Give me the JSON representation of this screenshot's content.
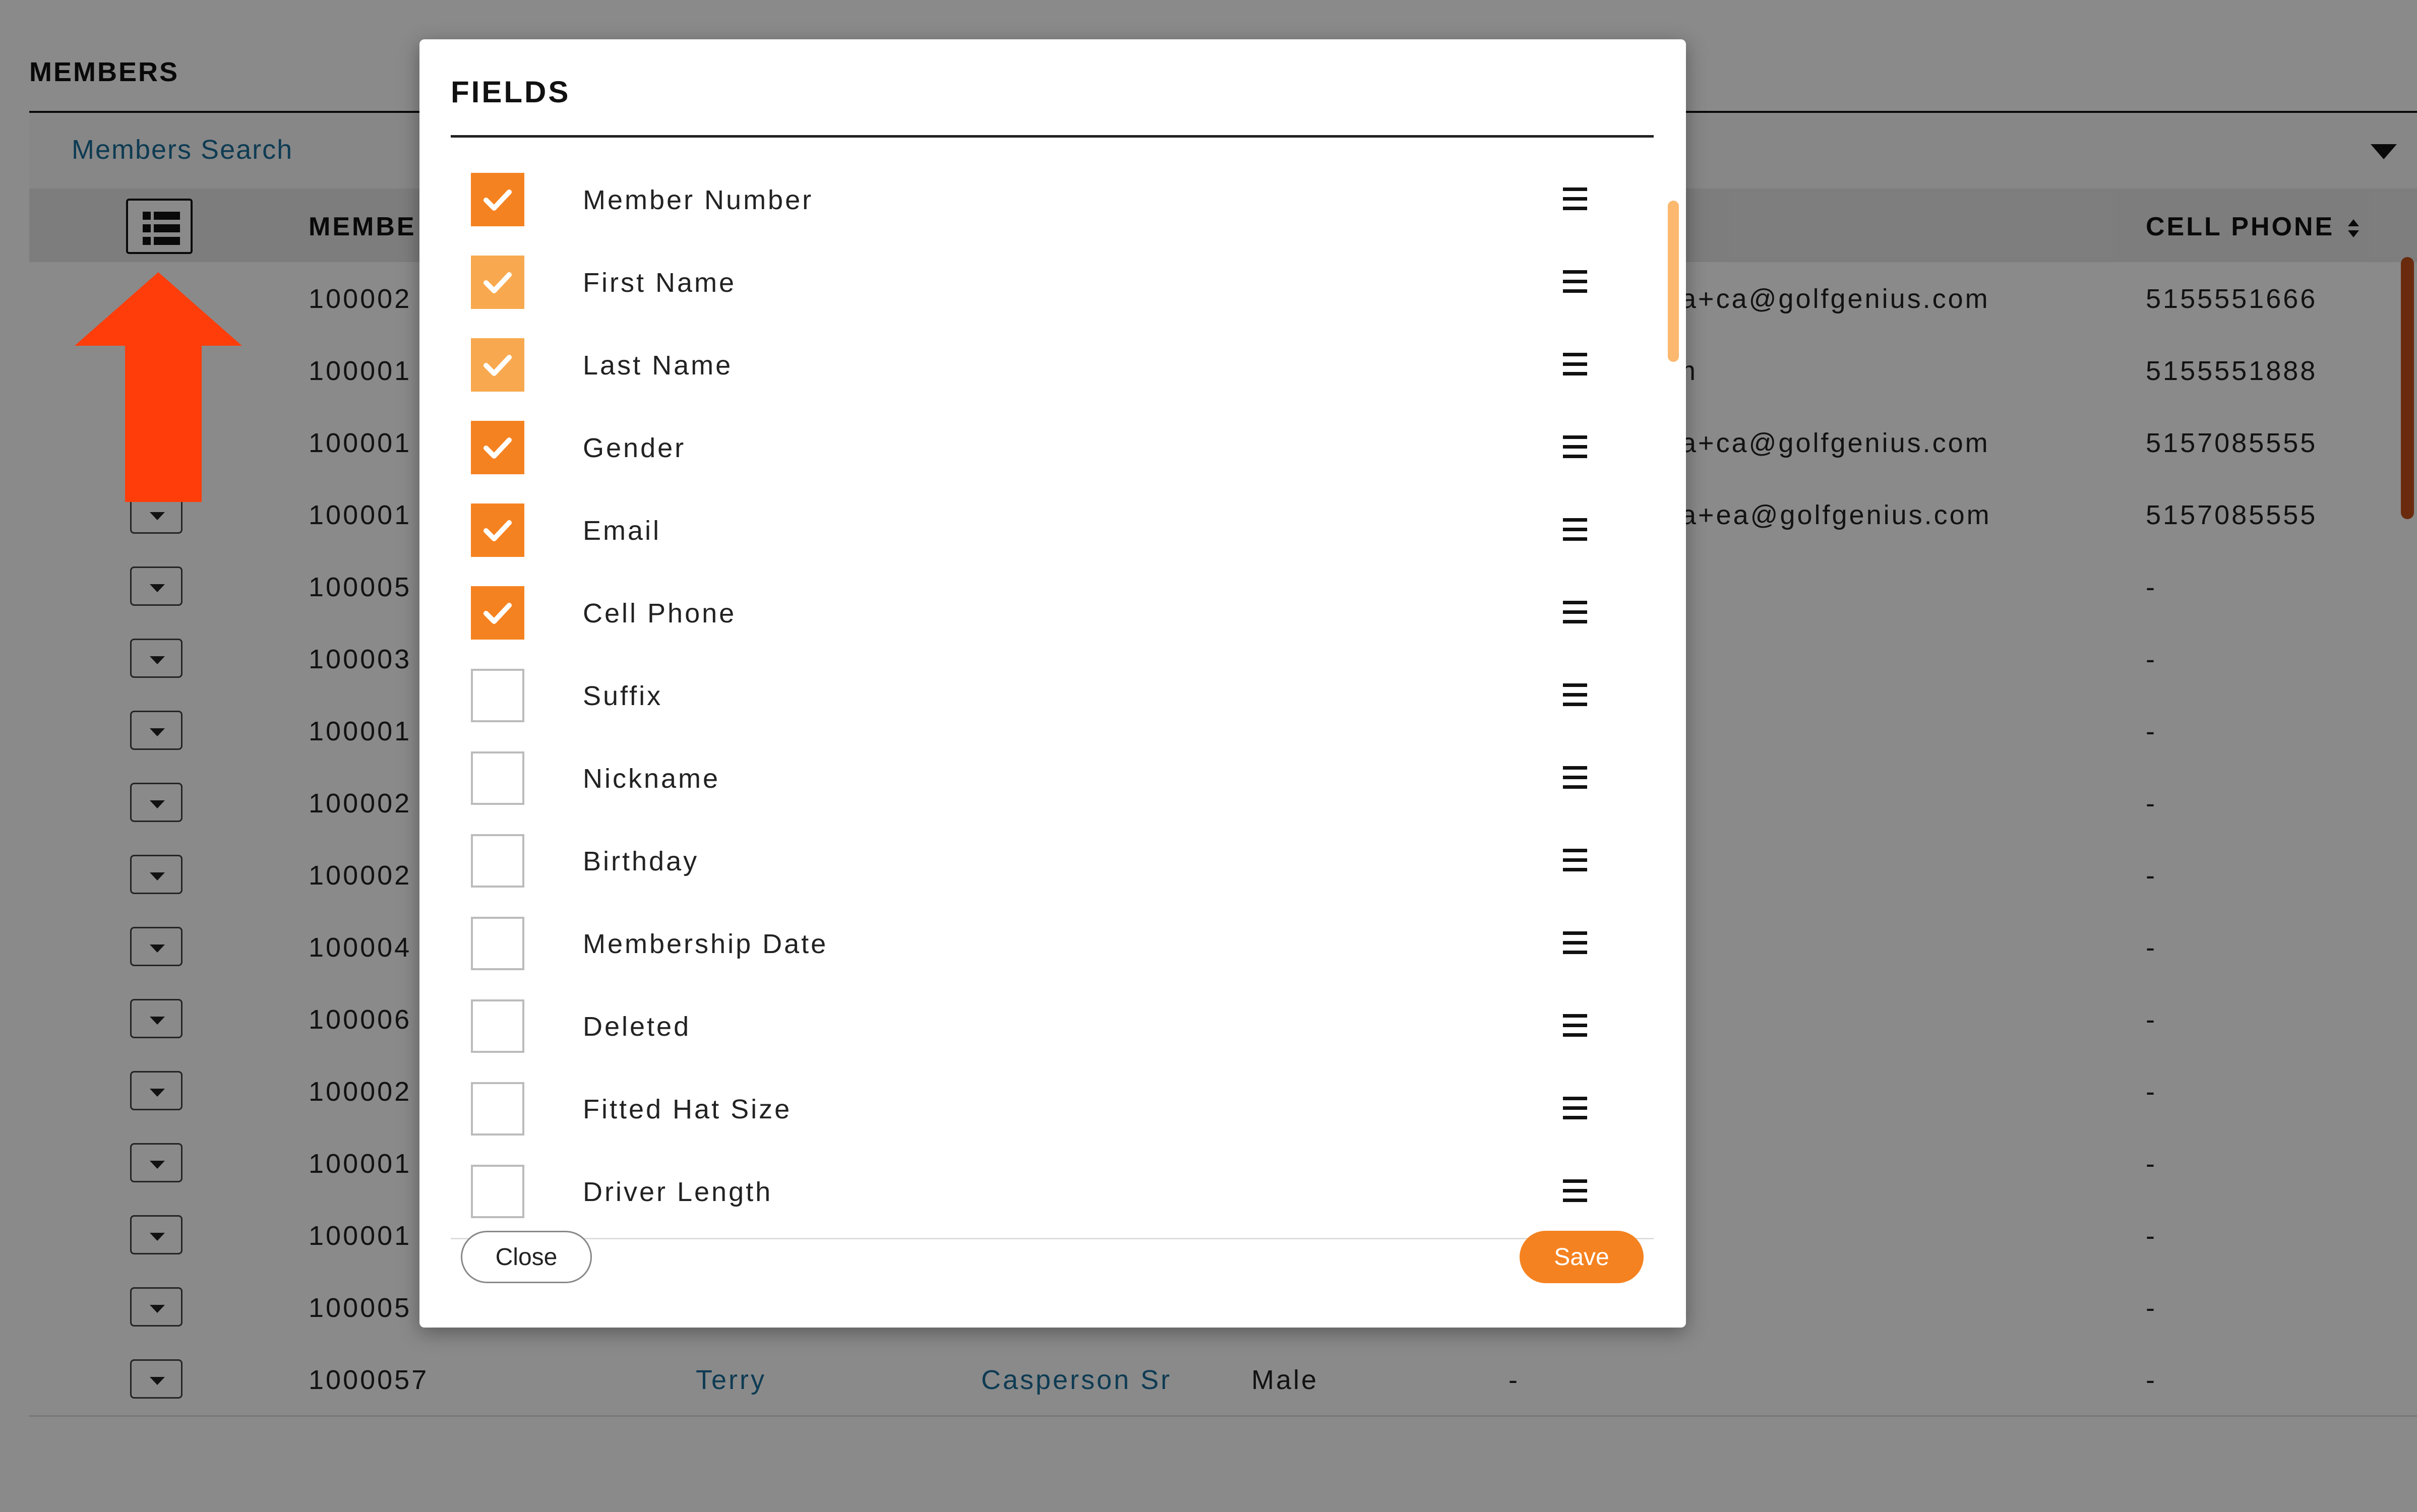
{
  "page": {
    "title": "MEMBERS",
    "search_label": "Members Search",
    "columns": {
      "member": "MEMBE",
      "cell_phone": "CELL PHONE"
    },
    "rows": [
      {
        "number": "100002",
        "email": "la+ca@golfgenius.com",
        "phone": "5155551666"
      },
      {
        "number": "100001",
        "email": "m",
        "phone": "5155551888"
      },
      {
        "number": "100001",
        "email": "la+ca@golfgenius.com",
        "phone": "5157085555"
      },
      {
        "number": "100001",
        "email": "la+ea@golfgenius.com",
        "phone": "5157085555"
      },
      {
        "number": "100005",
        "email": "",
        "phone": "-"
      },
      {
        "number": "100003",
        "email": "",
        "phone": "-"
      },
      {
        "number": "100001",
        "email": "",
        "phone": "-"
      },
      {
        "number": "100002",
        "email": "",
        "phone": "-"
      },
      {
        "number": "100002",
        "email": "",
        "phone": "-"
      },
      {
        "number": "100004",
        "email": "",
        "phone": "-"
      },
      {
        "number": "100006",
        "email": "",
        "phone": "-"
      },
      {
        "number": "100002",
        "email": "",
        "phone": "-"
      },
      {
        "number": "100001",
        "email": "",
        "phone": "-"
      },
      {
        "number": "100001",
        "email": "",
        "phone": "-"
      },
      {
        "number": "100005",
        "email": "",
        "phone": "-"
      }
    ],
    "last_row": {
      "number": "1000057",
      "first": "Terry",
      "last": "Casperson Sr",
      "gender": "Male",
      "email": "-",
      "phone": "-"
    }
  },
  "modal": {
    "title": "FIELDS",
    "fields": [
      {
        "label": "Member Number",
        "checked": true,
        "light": false
      },
      {
        "label": "First Name",
        "checked": true,
        "light": true
      },
      {
        "label": "Last Name",
        "checked": true,
        "light": true
      },
      {
        "label": "Gender",
        "checked": true,
        "light": false
      },
      {
        "label": "Email",
        "checked": true,
        "light": false
      },
      {
        "label": "Cell Phone",
        "checked": true,
        "light": false
      },
      {
        "label": "Suffix",
        "checked": false,
        "light": false
      },
      {
        "label": "Nickname",
        "checked": false,
        "light": false
      },
      {
        "label": "Birthday",
        "checked": false,
        "light": false
      },
      {
        "label": "Membership Date",
        "checked": false,
        "light": false
      },
      {
        "label": "Deleted",
        "checked": false,
        "light": false
      },
      {
        "label": "Fitted Hat Size",
        "checked": false,
        "light": false
      },
      {
        "label": "Driver Length",
        "checked": false,
        "light": false
      }
    ],
    "close_label": "Close",
    "save_label": "Save"
  },
  "icons": {
    "fields_button": "list-icon",
    "drag_handle": "drag-handle-icon",
    "check": "check-icon",
    "annotation": "red-arrow"
  },
  "colors": {
    "accent": "#f58220",
    "accent_light": "#f8a94f",
    "link": "#1a6e9a",
    "annotation": "#ff3d0a"
  }
}
